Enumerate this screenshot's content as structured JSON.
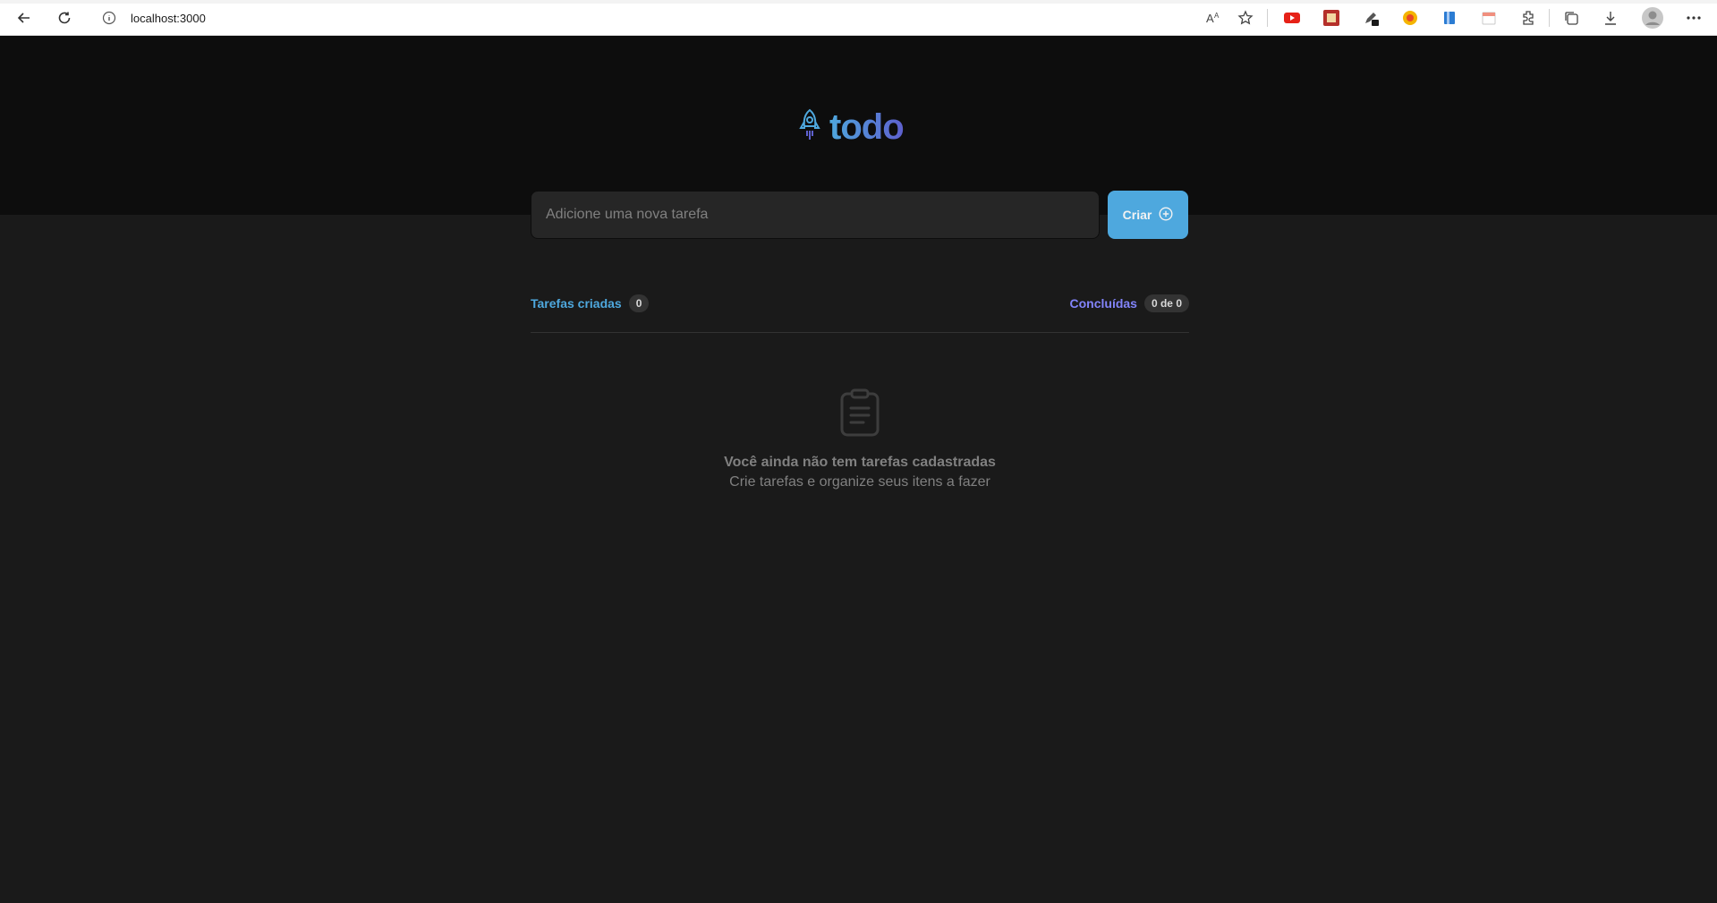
{
  "browser": {
    "url": "localhost:3000",
    "icons": [
      "back-icon",
      "reload-icon",
      "info-icon",
      "read-aloud-icon",
      "favorite-icon",
      "youtube-ext-icon",
      "ext-red-icon",
      "ext-pen-icon",
      "ext-yellow-icon",
      "ext-blue-icon",
      "ext-calendar-icon",
      "extensions-icon",
      "collections-icon",
      "download-icon",
      "profile-icon",
      "more-icon"
    ]
  },
  "app": {
    "logo_text": "todo",
    "input_placeholder": "Adicione uma nova tarefa",
    "create_label": "Criar",
    "created_label": "Tarefas criadas",
    "created_count": "0",
    "done_label": "Concluídas",
    "done_count": "0 de 0",
    "empty_title": "Você ainda não tem tarefas cadastradas",
    "empty_subtitle": "Crie tarefas e organize seus itens a fazer"
  },
  "colors": {
    "blue": "#4ea8de",
    "purple": "#8284fa",
    "header_bg": "#0d0d0d",
    "body_bg": "#1a1a1a"
  }
}
